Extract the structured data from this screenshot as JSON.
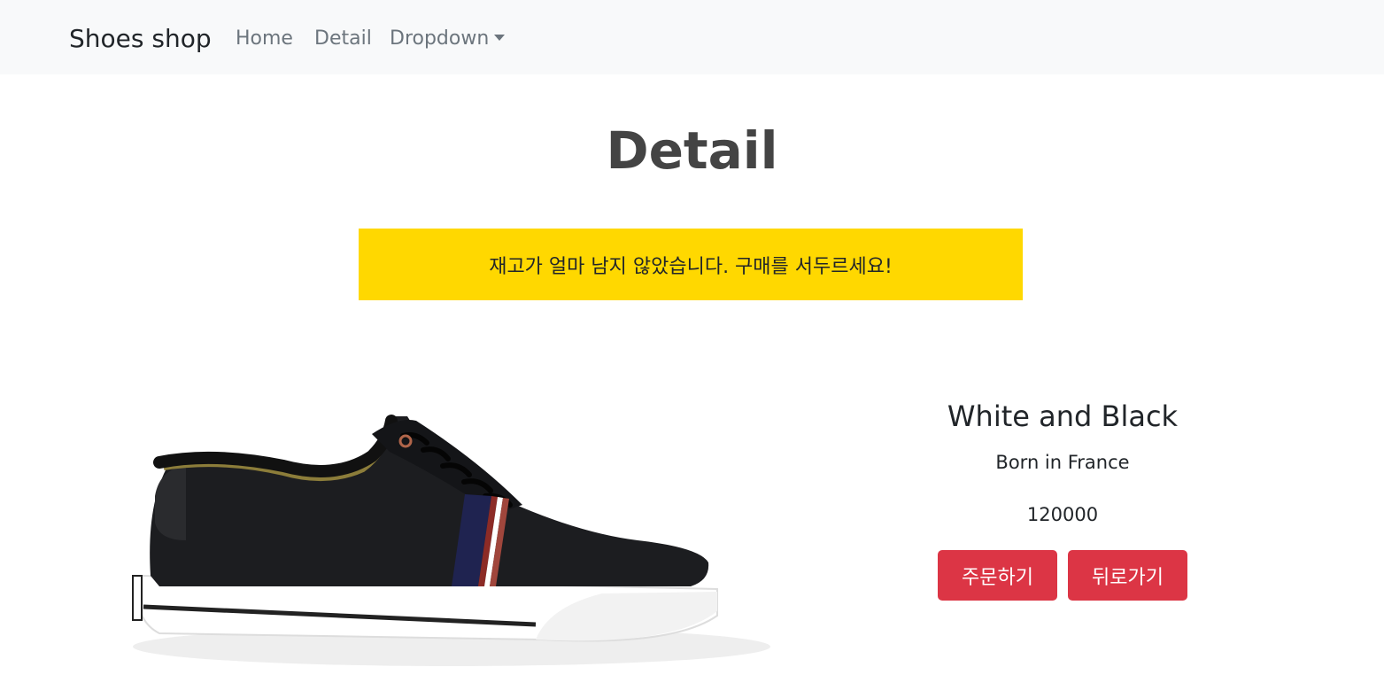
{
  "navbar": {
    "brand": "Shoes shop",
    "links": [
      "Home",
      "Detail"
    ],
    "dropdown_label": "Dropdown",
    "background": "#f8f9fa"
  },
  "page": {
    "title": "Detail",
    "alert_text": "재고가 얼마 남지 않았습니다. 구매를 서두르세요!",
    "alert_color": "#ffd800"
  },
  "product": {
    "image_icon": "black-sneaker-image",
    "name": "White and Black",
    "origin": "Born in France",
    "price": "120000",
    "order_button": "주문하기",
    "back_button": "뒤로가기",
    "button_color": "#dc3545"
  }
}
